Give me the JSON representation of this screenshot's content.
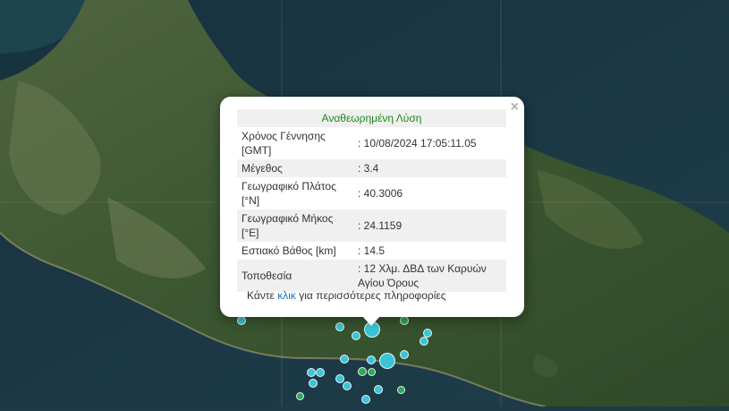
{
  "map": {
    "colors": {
      "sea": "#1d3a46",
      "land": "#3f5a35",
      "marker_cyan": "#3cc4d6",
      "marker_green": "#2fa85a"
    },
    "markers": [
      {
        "id": "m1",
        "color": "cyan",
        "size": "large"
      },
      {
        "id": "m2",
        "color": "cyan",
        "size": "large"
      },
      {
        "id": "m3",
        "color": "cyan",
        "size": "small"
      },
      {
        "id": "m4",
        "color": "green",
        "size": "small"
      }
    ]
  },
  "popup": {
    "close": "×",
    "header": "Αναθεωρημένη Λύση",
    "rows": [
      {
        "label": "Χρόνος Γέννησης [GMT]",
        "value": ": 10/08/2024 17:05:11.05"
      },
      {
        "label": "Μέγεθος",
        "value": ": 3.4"
      },
      {
        "label": "Γεωγραφικό Πλάτος [°N]",
        "value": ": 40.3006"
      },
      {
        "label": "Γεωγραφικό Μήκος [°E]",
        "value": ": 24.1159"
      },
      {
        "label": "Εστιακό Βάθος [km]",
        "value": ": 14.5"
      },
      {
        "label": "Τοποθεσία",
        "value": ": 12 Χλμ. ΔΒΔ των Καρυών Αγίου Όρους"
      }
    ],
    "footer_pre": "Κάντε ",
    "footer_link": "κλικ",
    "footer_post": " για περισσότερες πληροφορίες"
  }
}
